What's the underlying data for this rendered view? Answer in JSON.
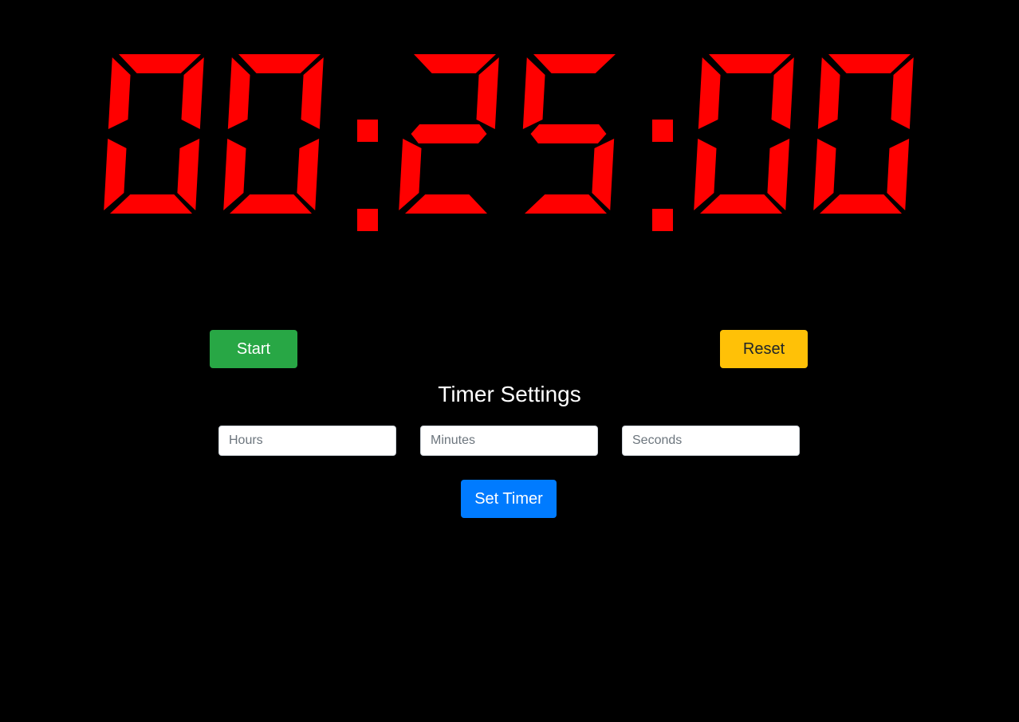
{
  "timer": {
    "display": "00:25:00",
    "digit_color": "#ff0000"
  },
  "controls": {
    "start_label": "Start",
    "reset_label": "Reset"
  },
  "settings": {
    "title": "Timer Settings",
    "hours_placeholder": "Hours",
    "minutes_placeholder": "Minutes",
    "seconds_placeholder": "Seconds",
    "hours_value": "",
    "minutes_value": "",
    "seconds_value": "",
    "set_label": "Set Timer"
  },
  "colors": {
    "background": "#000000",
    "start": "#28a745",
    "reset": "#ffc107",
    "set": "#007bff"
  }
}
